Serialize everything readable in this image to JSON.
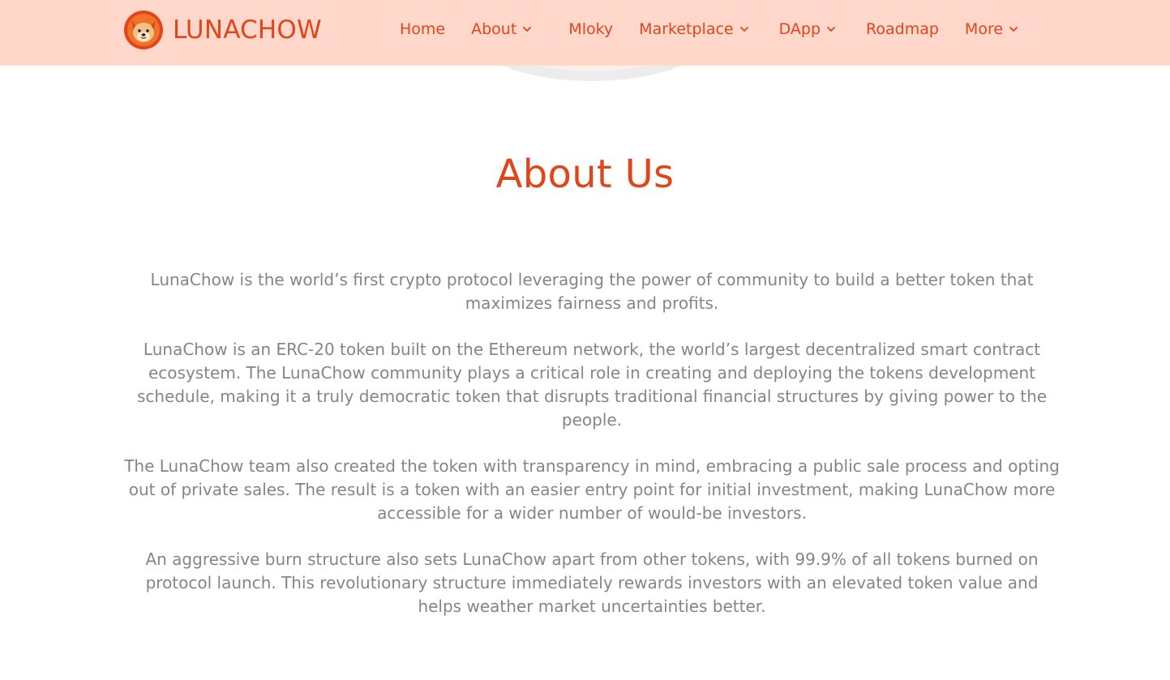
{
  "header": {
    "brand": "LUNACHOW",
    "nav": [
      {
        "label": "Home",
        "has_dropdown": false
      },
      {
        "label": "About",
        "has_dropdown": true
      },
      {
        "label": "Mloky",
        "has_dropdown": false
      },
      {
        "label": "Marketplace",
        "has_dropdown": true
      },
      {
        "label": "DApp",
        "has_dropdown": true
      },
      {
        "label": "Roadmap",
        "has_dropdown": false
      },
      {
        "label": "More",
        "has_dropdown": true
      }
    ]
  },
  "about": {
    "title": "About Us",
    "paragraphs": [
      "LunaChow is the world’s first crypto protocol leveraging the power of community to build a better token that maximizes fairness and profits.",
      "LunaChow is an ERC-20 token built on the Ethereum network, the world’s largest decentralized smart contract ecosystem. The LunaChow community plays a critical role in creating and deploying the tokens development schedule, making it a truly democratic token that disrupts traditional financial structures by giving power to the people.",
      "The LunaChow team also created the token with transparency in mind, embracing a public sale process and opting out of private sales. The result is a token with an easier entry point for initial investment, making LunaChow more accessible for a wider number of would-be investors.",
      "An aggressive burn structure also sets LunaChow apart from other tokens, with 99.9% of all tokens burned on protocol launch. This revolutionary structure immediately rewards investors with an elevated token value and helps weather market uncertainties better."
    ]
  },
  "colors": {
    "header_bg": "#ffd7cb",
    "accent": "#e0461a",
    "body_text": "#858585",
    "page_bg": "#ffffff"
  },
  "icons": {
    "logo": "shiba-dog-face-icon",
    "dropdown": "chevron-down-icon"
  }
}
